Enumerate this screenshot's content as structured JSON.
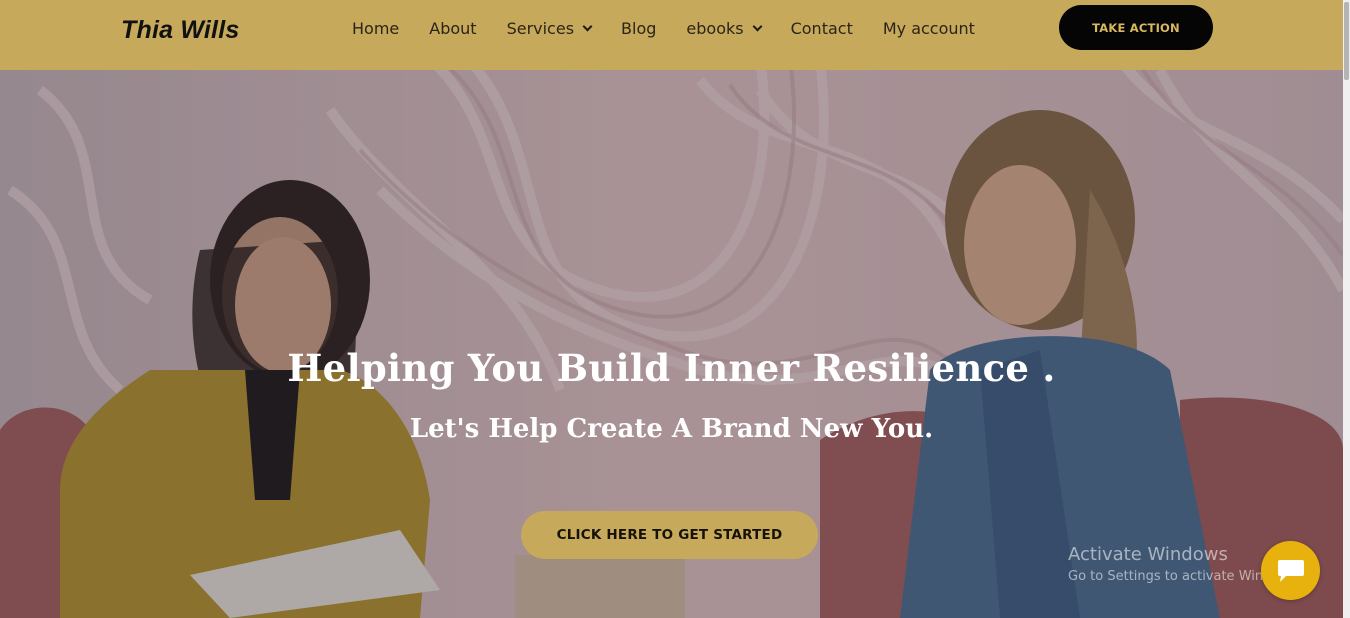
{
  "site": {
    "logo": "Thia Wills"
  },
  "nav": {
    "items": [
      {
        "label": "Home",
        "dropdown": false
      },
      {
        "label": "About",
        "dropdown": false
      },
      {
        "label": "Services",
        "dropdown": true
      },
      {
        "label": "Blog",
        "dropdown": false
      },
      {
        "label": "ebooks",
        "dropdown": true
      },
      {
        "label": "Contact",
        "dropdown": false
      },
      {
        "label": "My account",
        "dropdown": false
      }
    ],
    "cta_label": "TAKE ACTION"
  },
  "hero": {
    "headline": "Helping You Build Inner Resilience .",
    "subheadline": "Let's Help Create A Brand New You.",
    "cta_label": "CLICK HERE TO GET STARTED"
  },
  "watermark": {
    "title": "Activate Windows",
    "subtitle": "Go to Settings to activate Windows."
  },
  "icons": {
    "chat": "chat-bubble-icon",
    "dropdown": "chevron-down-icon"
  },
  "colors": {
    "header_bg": "#c6a95a",
    "accent_gold": "#c6a95a",
    "cta_dark": "#050505",
    "cta_dark_text": "#d9b860",
    "chat_bg": "#e7b10e"
  }
}
